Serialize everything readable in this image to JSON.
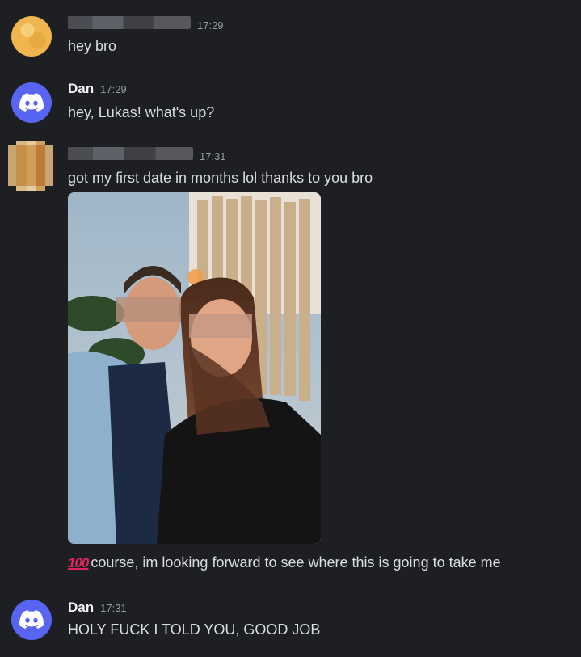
{
  "messages": [
    {
      "author": "",
      "author_hidden": true,
      "time": "17:29",
      "text": "hey bro",
      "avatar": "pixelated-avatar"
    },
    {
      "author": "Dan",
      "time": "17:29",
      "text": "hey, Lukas! what's up?",
      "avatar": "discord-logo-icon"
    },
    {
      "author": "",
      "author_hidden": true,
      "time": "17:31",
      "text": "got my first date in months lol thanks to you bro",
      "avatar": "pixelated-avatar",
      "attachment": "photo",
      "followup_emoji": "100",
      "followup_text": "course, im looking forward to see where this is going to take me"
    },
    {
      "author": "Dan",
      "time": "17:31",
      "text": "HOLY FUCK I TOLD YOU, GOOD JOB",
      "avatar": "discord-logo-icon"
    }
  ],
  "colors": {
    "background": "#1e1f22",
    "discord_blurple": "#5865f2",
    "text": "#dbdee1",
    "timestamp": "#949ba4",
    "emoji_red": "#e0245e"
  }
}
